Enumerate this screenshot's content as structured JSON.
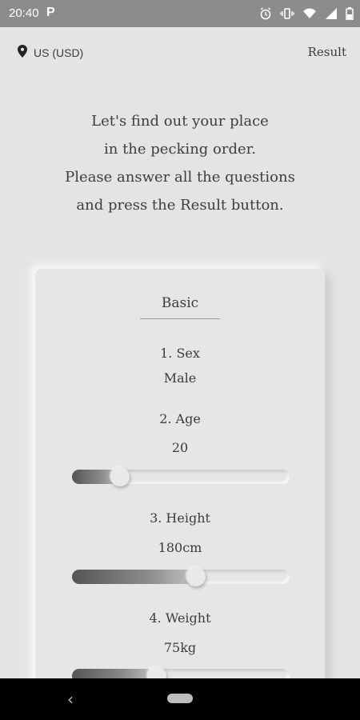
{
  "status_bar": {
    "time": "20:40",
    "app_badge": "P",
    "icons": [
      "alarm-icon",
      "vibrate-icon",
      "wifi-icon",
      "signal-icon",
      "battery-icon"
    ]
  },
  "header": {
    "location_label": "US (USD)",
    "location_icon": "location-pin-icon",
    "result_label": "Result"
  },
  "intro": {
    "lines": [
      "Let's find out your place",
      "in the pecking order.",
      "Please answer all the questions",
      "and press the Result button."
    ]
  },
  "card": {
    "section_title": "Basic",
    "questions": [
      {
        "label": "1. Sex",
        "value": "Male"
      },
      {
        "label": "2. Age",
        "value": "20",
        "slider_level": 0.22
      },
      {
        "label": "3. Height",
        "value": "180cm",
        "slider_level": 0.57
      },
      {
        "label": "4. Weight",
        "value": "75kg",
        "slider_level": 0.39
      }
    ]
  },
  "colors": {
    "background": "#e4e4e4",
    "status_bar": "#8c8c8c",
    "text": "#3b3b3b",
    "nav_bar": "#000000"
  }
}
